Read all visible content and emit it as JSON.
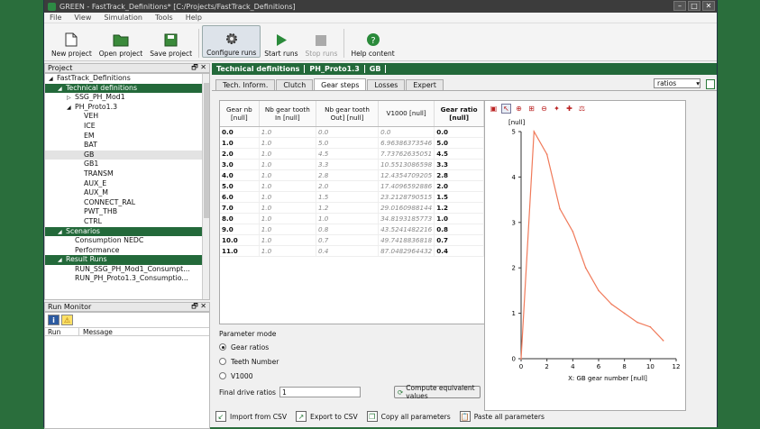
{
  "window": {
    "title": "GREEN - FastTrack_Definitions* [C:/Projects/FastTrack_Definitions]"
  },
  "menu": [
    "File",
    "View",
    "Simulation",
    "Tools",
    "Help"
  ],
  "toolbar": {
    "new_project": "New project",
    "open_project": "Open project",
    "save_project": "Save project",
    "configure_runs": "Configure runs",
    "start_runs": "Start runs",
    "stop_runs": "Stop runs",
    "help_content": "Help content"
  },
  "project_panel": {
    "title": "Project",
    "items": [
      {
        "label": "FastTrack_Definitions",
        "level": 0,
        "arrow": "◢",
        "state": ""
      },
      {
        "label": "Technical definitions",
        "level": 1,
        "arrow": "◢",
        "state": "sel"
      },
      {
        "label": "SSG_PH_Mod1",
        "level": 2,
        "arrow": "▷",
        "state": ""
      },
      {
        "label": "PH_Proto1.3",
        "level": 2,
        "arrow": "◢",
        "state": ""
      },
      {
        "label": "VEH",
        "level": 3,
        "arrow": "",
        "state": ""
      },
      {
        "label": "ICE",
        "level": 3,
        "arrow": "",
        "state": ""
      },
      {
        "label": "EM",
        "level": 3,
        "arrow": "",
        "state": ""
      },
      {
        "label": "BAT",
        "level": 3,
        "arrow": "",
        "state": ""
      },
      {
        "label": "GB",
        "level": 3,
        "arrow": "",
        "state": "hl"
      },
      {
        "label": "GB1",
        "level": 3,
        "arrow": "",
        "state": ""
      },
      {
        "label": "TRANSM",
        "level": 3,
        "arrow": "",
        "state": ""
      },
      {
        "label": "AUX_E",
        "level": 3,
        "arrow": "",
        "state": ""
      },
      {
        "label": "AUX_M",
        "level": 3,
        "arrow": "",
        "state": ""
      },
      {
        "label": "CONNECT_RAL",
        "level": 3,
        "arrow": "",
        "state": ""
      },
      {
        "label": "PWT_THB",
        "level": 3,
        "arrow": "",
        "state": ""
      },
      {
        "label": "CTRL",
        "level": 3,
        "arrow": "",
        "state": ""
      },
      {
        "label": "Scenarios",
        "level": 1,
        "arrow": "◢",
        "state": "sel"
      },
      {
        "label": "Consumption NEDC",
        "level": 2,
        "arrow": "",
        "state": ""
      },
      {
        "label": "Performance",
        "level": 2,
        "arrow": "",
        "state": ""
      },
      {
        "label": "Result Runs",
        "level": 1,
        "arrow": "◢",
        "state": "sel"
      },
      {
        "label": "RUN_SSG_PH_Mod1_Consumpt...",
        "level": 2,
        "arrow": "",
        "state": ""
      },
      {
        "label": "RUN_PH_Proto1.3_Consumptio...",
        "level": 2,
        "arrow": "",
        "state": ""
      }
    ]
  },
  "run_monitor": {
    "title": "Run Monitor",
    "col_run": "Run",
    "col_message": "Message"
  },
  "main_header": [
    "Technical definitions",
    "PH_Proto1.3",
    "GB"
  ],
  "tabs": [
    "Tech. Inform.",
    "Clutch",
    "Gear steps",
    "Losses",
    "Expert"
  ],
  "active_tab": "Gear steps",
  "view_combo": "ratios",
  "table": {
    "headers": [
      "Gear nb [null]",
      "Nb gear tooth In [null]",
      "Nb gear tooth Out] [null]",
      "V1000 [null]",
      "Gear ratio [null]"
    ],
    "rows": [
      [
        "0.0",
        "1.0",
        "0.0",
        "0.0",
        "0.0"
      ],
      [
        "1.0",
        "1.0",
        "5.0",
        "6.96386373546",
        "5.0"
      ],
      [
        "2.0",
        "1.0",
        "4.5",
        "7.73762635051",
        "4.5"
      ],
      [
        "3.0",
        "1.0",
        "3.3",
        "10.5513086598",
        "3.3"
      ],
      [
        "4.0",
        "1.0",
        "2.8",
        "12.4354709205",
        "2.8"
      ],
      [
        "5.0",
        "1.0",
        "2.0",
        "17.4096592886",
        "2.0"
      ],
      [
        "6.0",
        "1.0",
        "1.5",
        "23.2128790515",
        "1.5"
      ],
      [
        "7.0",
        "1.0",
        "1.2",
        "29.0160988144",
        "1.2"
      ],
      [
        "8.0",
        "1.0",
        "1.0",
        "34.8193185773",
        "1.0"
      ],
      [
        "9.0",
        "1.0",
        "0.8",
        "43.5241482216",
        "0.8"
      ],
      [
        "10.0",
        "1.0",
        "0.7",
        "49.7418836818",
        "0.7"
      ],
      [
        "11.0",
        "1.0",
        "0.4",
        "87.0482964432",
        "0.4"
      ]
    ]
  },
  "param_mode": {
    "title": "Parameter mode",
    "options": [
      "Gear ratios",
      "Teeth Number",
      "V1000"
    ],
    "selected": "Gear ratios",
    "final_label": "Final drive ratios",
    "final_value": "1",
    "compute_label": "Compute equivalent values"
  },
  "bottom_buttons": {
    "import": "Import from CSV",
    "export": "Export to CSV",
    "copy": "Copy all parameters",
    "paste": "Paste all parameters"
  },
  "chart_data": {
    "type": "line",
    "ylabel": "[null]",
    "xlabel": "X: GB gear number [null]",
    "xlim": [
      0,
      12
    ],
    "ylim": [
      0,
      5
    ],
    "x_ticks": [
      0,
      2,
      4,
      6,
      8,
      10,
      12
    ],
    "y_ticks": [
      0,
      1,
      2,
      3,
      4,
      5
    ],
    "line_color": "#f07a5a",
    "x": [
      0,
      1,
      2,
      3,
      4,
      5,
      6,
      7,
      8,
      9,
      10,
      11
    ],
    "y": [
      0.0,
      5.0,
      4.5,
      3.3,
      2.8,
      2.0,
      1.5,
      1.2,
      1.0,
      0.8,
      0.7,
      0.4
    ]
  }
}
